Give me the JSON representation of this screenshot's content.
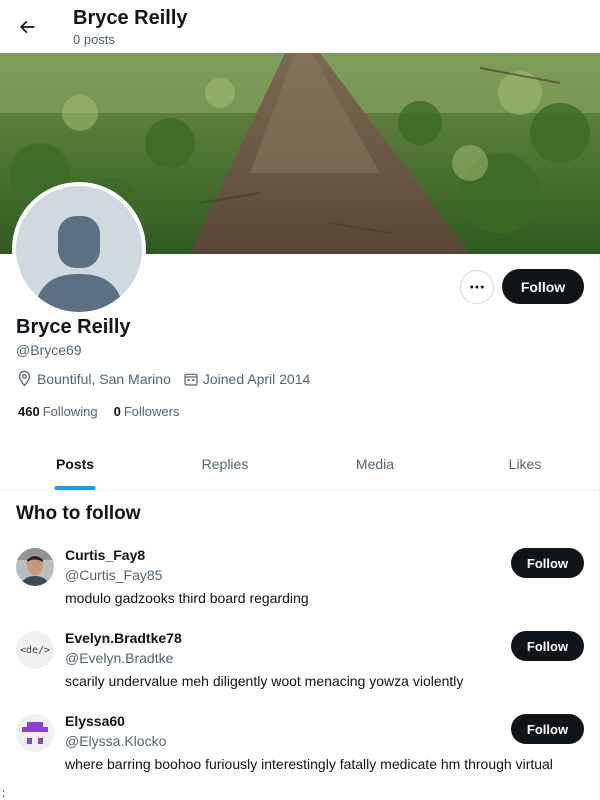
{
  "header": {
    "title": "Bryce Reilly",
    "subtitle": "0 posts",
    "back_icon": "arrow-left-icon"
  },
  "profile": {
    "name": "Bryce Reilly",
    "handle": "@Bryce69",
    "location": "Bountiful, San Marino",
    "joined": "Joined April 2014",
    "following_count": "460",
    "following_label": "Following",
    "followers_count": "0",
    "followers_label": "Followers",
    "follow_label": "Follow",
    "more_icon": "more-horizontal-icon"
  },
  "tabs": [
    {
      "label": "Posts",
      "active": true
    },
    {
      "label": "Replies",
      "active": false
    },
    {
      "label": "Media",
      "active": false
    },
    {
      "label": "Likes",
      "active": false
    }
  ],
  "who_to_follow": {
    "title": "Who to follow",
    "users": [
      {
        "name": "Curtis_Fay8",
        "handle": "@Curtis_Fay85",
        "bio": "modulo gadzooks third board regarding",
        "follow_label": "Follow"
      },
      {
        "name": "Evelyn.Bradtke78",
        "handle": "@Evelyn.Bradtke",
        "bio": "scarily undervalue meh diligently woot menacing yowza violently",
        "follow_label": "Follow",
        "avatar_text": "<de/>"
      },
      {
        "name": "Elyssa60",
        "handle": "@Elyssa.Klocko",
        "bio": "where barring boohoo furiously interestingly fatally medicate hm through virtual",
        "follow_label": "Follow"
      }
    ]
  },
  "stray_text": ":",
  "colors": {
    "accent": "#1d9bf0",
    "text_primary": "#0f1419",
    "text_secondary": "#536471",
    "button_dark": "#0f1419",
    "avatar_placeholder": "#cfd9de"
  }
}
